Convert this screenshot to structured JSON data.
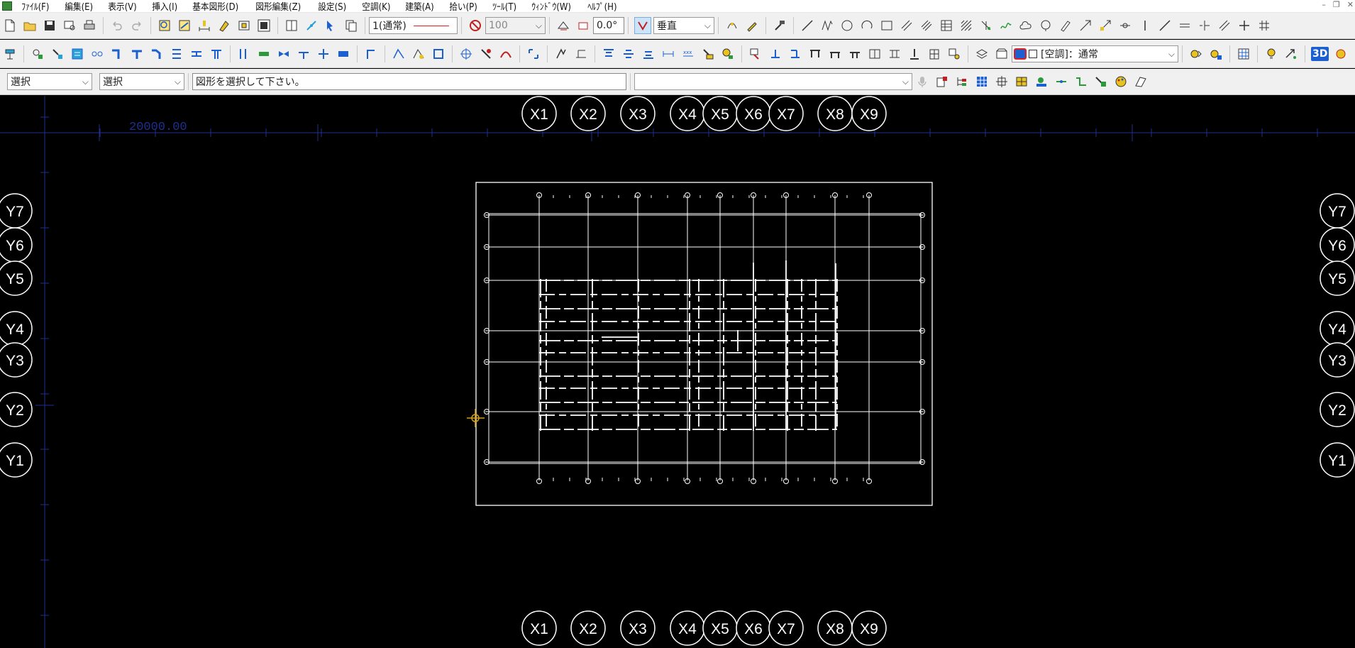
{
  "menubar": {
    "items": [
      "ﾌｧｲﾙ(F)",
      "編集(E)",
      "表示(V)",
      "挿入(I)",
      "基本図形(D)",
      "図形編集(Z)",
      "設定(S)",
      "空調(K)",
      "建築(A)",
      "拾い(P)",
      "ﾂｰﾙ(T)",
      "ｳｨﾝﾄﾞｳ(W)",
      "ﾍﾙﾌﾟ(H)"
    ]
  },
  "toolbar1": {
    "layer_combo": "1(通常)",
    "scale_value": "100",
    "angle_value": "0.0°",
    "direction_combo": "垂直"
  },
  "toolbar2": {
    "layer_select": "[空調]：通常",
    "label_3d": "3D"
  },
  "toolbar3": {
    "mode_combo1": "選択",
    "mode_combo2": "選択",
    "prompt_text": "図形を選択して下さい。",
    "command_combo": ""
  },
  "drawing": {
    "dimension_text": "20000.00",
    "x_axes": [
      "X1",
      "X2",
      "X3",
      "X4",
      "X5",
      "X6",
      "X7",
      "X8",
      "X9"
    ],
    "y_axes": [
      "Y7",
      "Y6",
      "Y5",
      "Y4",
      "Y3",
      "Y2",
      "Y1"
    ],
    "colors": {
      "background": "#000000",
      "grid": "#1f2f8f",
      "lines": "#ffffff",
      "cursor": "#d4a017"
    }
  }
}
